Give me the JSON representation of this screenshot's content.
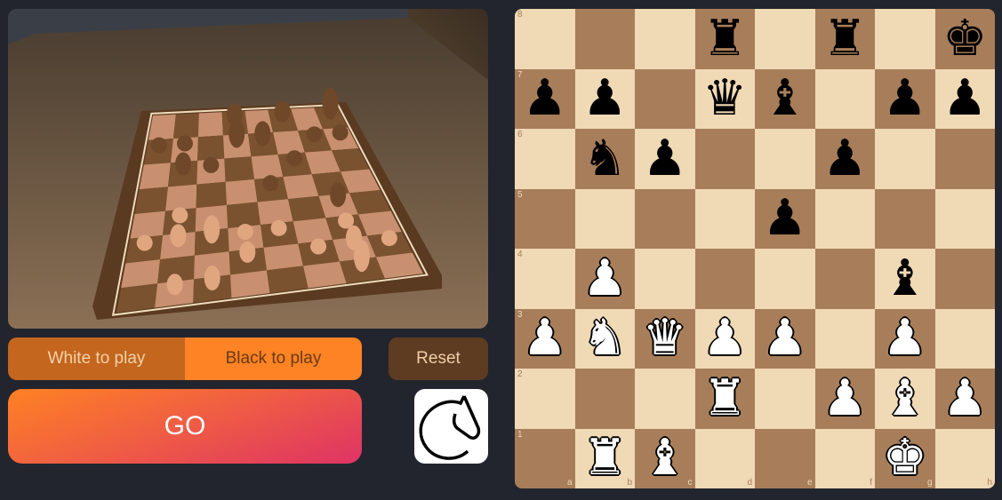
{
  "scene": {
    "description": "3D rendered chessboard on wooden table"
  },
  "controls": {
    "white_to_play": "White to play",
    "black_to_play": "Black to play",
    "reset": "Reset",
    "go": "GO",
    "logo": "lichess-knight-logo"
  },
  "colors": {
    "light_square": "#f0d9b5",
    "dark_square": "#a87e5a",
    "go_gradient_start": "#fe8123",
    "go_gradient_end": "#de3365",
    "selected_side": "#c4661d",
    "unselected_side": "#fd8325",
    "reset_bg": "#5e3c22"
  },
  "board": {
    "files": [
      "a",
      "b",
      "c",
      "d",
      "e",
      "f",
      "g",
      "h"
    ],
    "ranks": [
      "8",
      "7",
      "6",
      "5",
      "4",
      "3",
      "2",
      "1"
    ],
    "pieces": {
      "d8": "bR",
      "f8": "bR",
      "h8": "bK",
      "a7": "bP",
      "b7": "bP",
      "d7": "bQ",
      "e7": "bB",
      "g7": "bP",
      "h7": "bP",
      "b6": "bN",
      "c6": "bP",
      "f6": "bP",
      "e5": "bP",
      "b4": "wP",
      "g4": "bB",
      "a3": "wP",
      "b3": "wN",
      "c3": "wQ",
      "d3": "wP",
      "e3": "wP",
      "g3": "wP",
      "d2": "wR",
      "f2": "wP",
      "g2": "wB",
      "h2": "wP",
      "b1": "wR",
      "c1": "wB",
      "g1": "wK"
    }
  }
}
